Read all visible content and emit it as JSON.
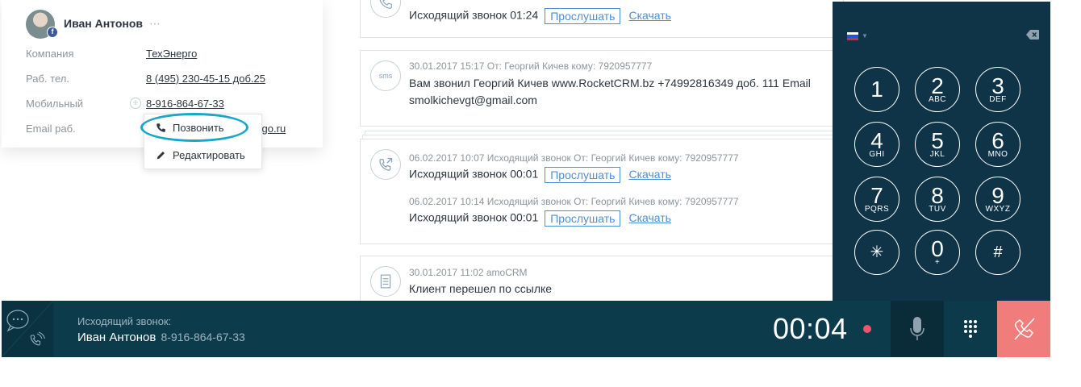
{
  "contact": {
    "name": "Иван Антонов",
    "more_icon": "⋯",
    "fields": [
      {
        "label": "Компания",
        "value": "ТехЭнерго"
      },
      {
        "label": "Раб. тел.",
        "value": "8 (495) 230-45-15 доб.25"
      },
      {
        "label": "Мобильный",
        "value": "8-916-864-67-33"
      },
      {
        "label": "Email раб.",
        "value": "ergo.ru"
      }
    ],
    "popup": {
      "call_label": "Позвонить",
      "edit_label": "Редактировать"
    }
  },
  "feed": {
    "item1": {
      "text": "Исходящий звонок 01:24",
      "listen": "Прослушать",
      "download": "Скачать"
    },
    "item2": {
      "icon": "sms",
      "meta": "30.01.2017 15:17 От: Георгий Кичев кому: 7920957777",
      "line1": "Вам звонил Георгий Кичев www.RocketCRM.bz +74992816349 доб. 111 Email",
      "line2": "smolkichevgt@gmail.com"
    },
    "item3": {
      "meta1": "06.02.2017 10:07 Исходящий звонок От: Георгий Кичев кому: 7920957777",
      "text1": "Исходящий звонок 00:01",
      "meta2": "06.02.2017 10:14 Исходящий звонок От: Георгий Кичев кому: 7920957777",
      "text2": "Исходящий звонок 00:01",
      "listen": "Прослушать",
      "download": "Скачать"
    },
    "item4": {
      "meta": "30.01.2017 11:02 amoCRM",
      "text": "Клиент перешел по ссылке"
    }
  },
  "dialer": {
    "keys": [
      {
        "num": "1",
        "sub": ""
      },
      {
        "num": "2",
        "sub": "ABC"
      },
      {
        "num": "3",
        "sub": "DEF"
      },
      {
        "num": "4",
        "sub": "GHI"
      },
      {
        "num": "5",
        "sub": "JKL"
      },
      {
        "num": "6",
        "sub": "MNO"
      },
      {
        "num": "7",
        "sub": "PQRS"
      },
      {
        "num": "8",
        "sub": "TUV"
      },
      {
        "num": "9",
        "sub": "WXYZ"
      },
      {
        "num": "✳",
        "sub": ""
      },
      {
        "num": "0",
        "sub": "+"
      },
      {
        "num": "#",
        "sub": ""
      }
    ]
  },
  "callbar": {
    "label": "Исходящий звонок:",
    "name": "Иван Антонов",
    "number": "8-916-864-67-33",
    "timer": "00:04"
  },
  "colors": {
    "dialer_bg": "#0f3447",
    "callbar_bg": "#0c3c4c",
    "hangup": "#f17c7c",
    "link": "#4a90d9",
    "recording": "#f0546a"
  }
}
